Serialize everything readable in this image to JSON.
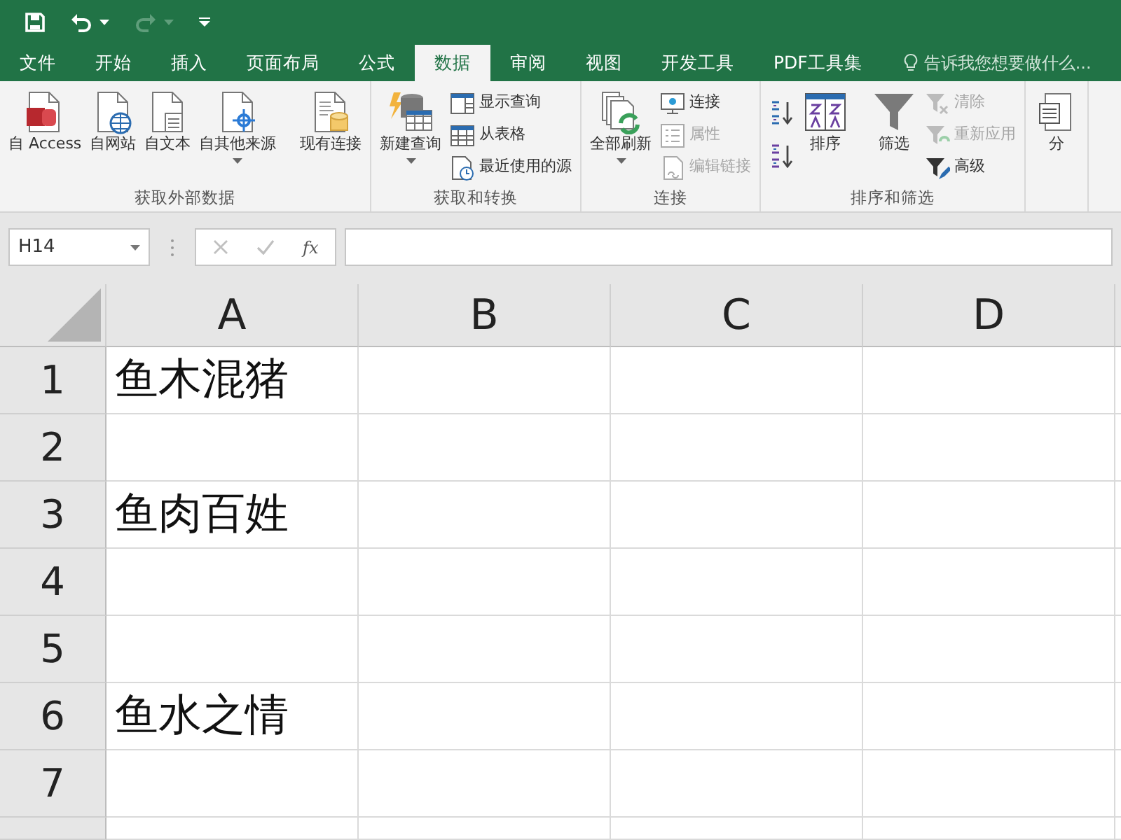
{
  "quick_access": [
    {
      "kind": "save"
    },
    {
      "kind": "undo",
      "disabled": false
    },
    {
      "kind": "redo",
      "disabled": true
    },
    {
      "kind": "customize"
    }
  ],
  "tabs": [
    {
      "label": "文件",
      "selected": false
    },
    {
      "label": "开始",
      "selected": false
    },
    {
      "label": "插入",
      "selected": false
    },
    {
      "label": "页面布局",
      "selected": false
    },
    {
      "label": "公式",
      "selected": false
    },
    {
      "label": "数据",
      "selected": true
    },
    {
      "label": "审阅",
      "selected": false
    },
    {
      "label": "视图",
      "selected": false
    },
    {
      "label": "开发工具",
      "selected": false
    },
    {
      "label": "PDF工具集",
      "selected": false
    }
  ],
  "tell_me": {
    "placeholder": "告诉我您想要做什么..."
  },
  "ribbon": {
    "groups": [
      {
        "label": "获取外部数据",
        "items": [
          {
            "kind": "large",
            "label": "自 Access",
            "disabled": false
          },
          {
            "kind": "large",
            "label": "自网站",
            "disabled": false
          },
          {
            "kind": "large",
            "label": "自文本",
            "disabled": false
          },
          {
            "kind": "large",
            "label": "自其他来源",
            "disabled": false,
            "dropdown": true
          },
          {
            "kind": "separator"
          },
          {
            "kind": "large",
            "label": "现有连接",
            "disabled": false
          }
        ]
      },
      {
        "label": "获取和转换",
        "items": [
          {
            "kind": "large",
            "label": "新建查询",
            "disabled": false,
            "dropdown": true
          },
          {
            "kind": "stack",
            "items": [
              {
                "label": "显示查询",
                "disabled": false
              },
              {
                "label": "从表格",
                "disabled": false
              },
              {
                "label": "最近使用的源",
                "disabled": false
              }
            ]
          }
        ]
      },
      {
        "label": "连接",
        "items": [
          {
            "kind": "large",
            "label": "全部刷新",
            "disabled": false,
            "dropdown": true
          },
          {
            "kind": "stack",
            "items": [
              {
                "label": "连接",
                "disabled": false
              },
              {
                "label": "属性",
                "disabled": true
              },
              {
                "label": "编辑链接",
                "disabled": true
              }
            ]
          }
        ]
      },
      {
        "label": "排序和筛选",
        "items": [
          {
            "kind": "stack",
            "items": [
              {
                "disabled": false
              },
              {
                "disabled": false
              }
            ]
          },
          {
            "kind": "large",
            "label": "排序",
            "disabled": false
          },
          {
            "kind": "separator"
          },
          {
            "kind": "large",
            "label": "筛选",
            "disabled": false
          },
          {
            "kind": "stack",
            "items": [
              {
                "label": "清除",
                "disabled": true
              },
              {
                "label": "重新应用",
                "disabled": true
              },
              {
                "label": "高级",
                "disabled": false
              }
            ]
          }
        ]
      },
      {
        "items": [
          {
            "kind": "large",
            "label": "分",
            "disabled": false
          }
        ]
      }
    ]
  },
  "formula_bar": {
    "name_box": "H14",
    "function_label": "fx"
  },
  "sheet": {
    "columns": [
      "A",
      "B",
      "C",
      "D"
    ],
    "rows": [
      {
        "number": "1",
        "cells": [
          "鱼木混猪",
          "",
          "",
          ""
        ]
      },
      {
        "number": "2",
        "cells": [
          "",
          "",
          "",
          ""
        ]
      },
      {
        "number": "3",
        "cells": [
          "鱼肉百姓",
          "",
          "",
          ""
        ]
      },
      {
        "number": "4",
        "cells": [
          "",
          "",
          "",
          ""
        ]
      },
      {
        "number": "5",
        "cells": [
          "",
          "",
          "",
          ""
        ]
      },
      {
        "number": "6",
        "cells": [
          "鱼水之情",
          "",
          "",
          ""
        ]
      },
      {
        "number": "7",
        "cells": [
          "",
          "",
          "",
          ""
        ]
      }
    ]
  }
}
